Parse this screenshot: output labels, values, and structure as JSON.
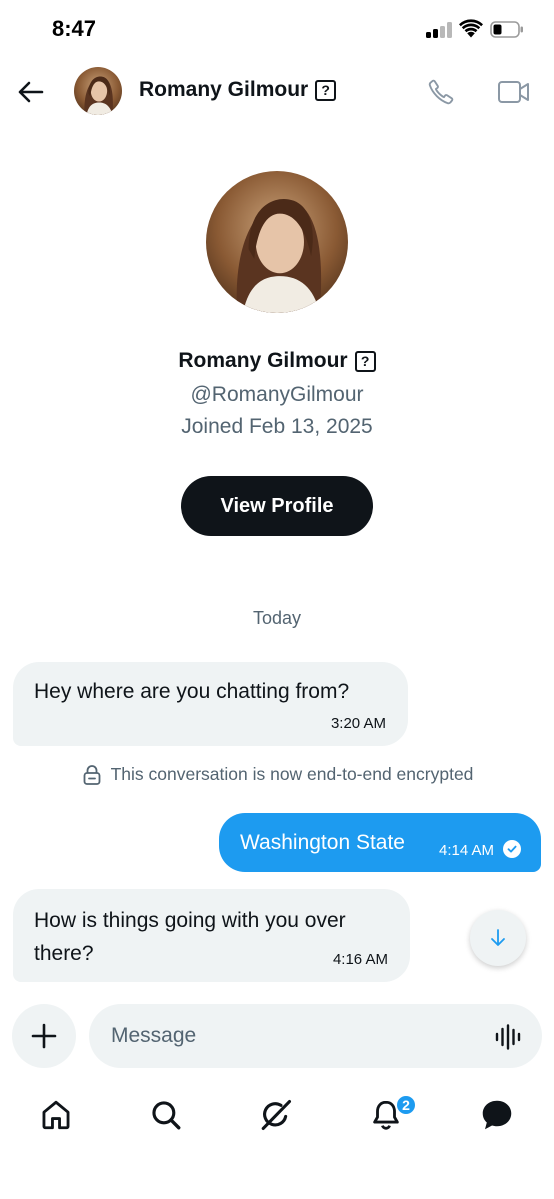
{
  "status_bar": {
    "time": "8:47"
  },
  "header": {
    "name": "Romany Gilmour",
    "badge": "?"
  },
  "profile": {
    "name": "Romany Gilmour",
    "badge": "?",
    "handle": "@RomanyGilmour",
    "joined": "Joined Feb 13, 2025",
    "view_profile_label": "View Profile"
  },
  "conversation": {
    "date_separator": "Today",
    "messages": [
      {
        "direction": "incoming",
        "text": "Hey where are you chatting from?",
        "time": "3:20 AM"
      },
      {
        "direction": "outgoing",
        "text": "Washington State",
        "time": "4:14 AM",
        "status": "read"
      },
      {
        "direction": "incoming",
        "text": "How is things going with you over there?",
        "time": "4:16 AM"
      }
    ],
    "encryption_notice": "This conversation is now end-to-end encrypted"
  },
  "composer": {
    "placeholder": "Message"
  },
  "bottom_nav": {
    "items": [
      {
        "icon": "home-icon"
      },
      {
        "icon": "search-icon"
      },
      {
        "icon": "grok-icon"
      },
      {
        "icon": "notifications-icon",
        "badge": "2"
      },
      {
        "icon": "messages-icon"
      }
    ]
  },
  "colors": {
    "accent": "#1d9bf0",
    "text": "#0f1419",
    "secondary_text": "#536471",
    "bubble_incoming": "#eff3f4"
  }
}
